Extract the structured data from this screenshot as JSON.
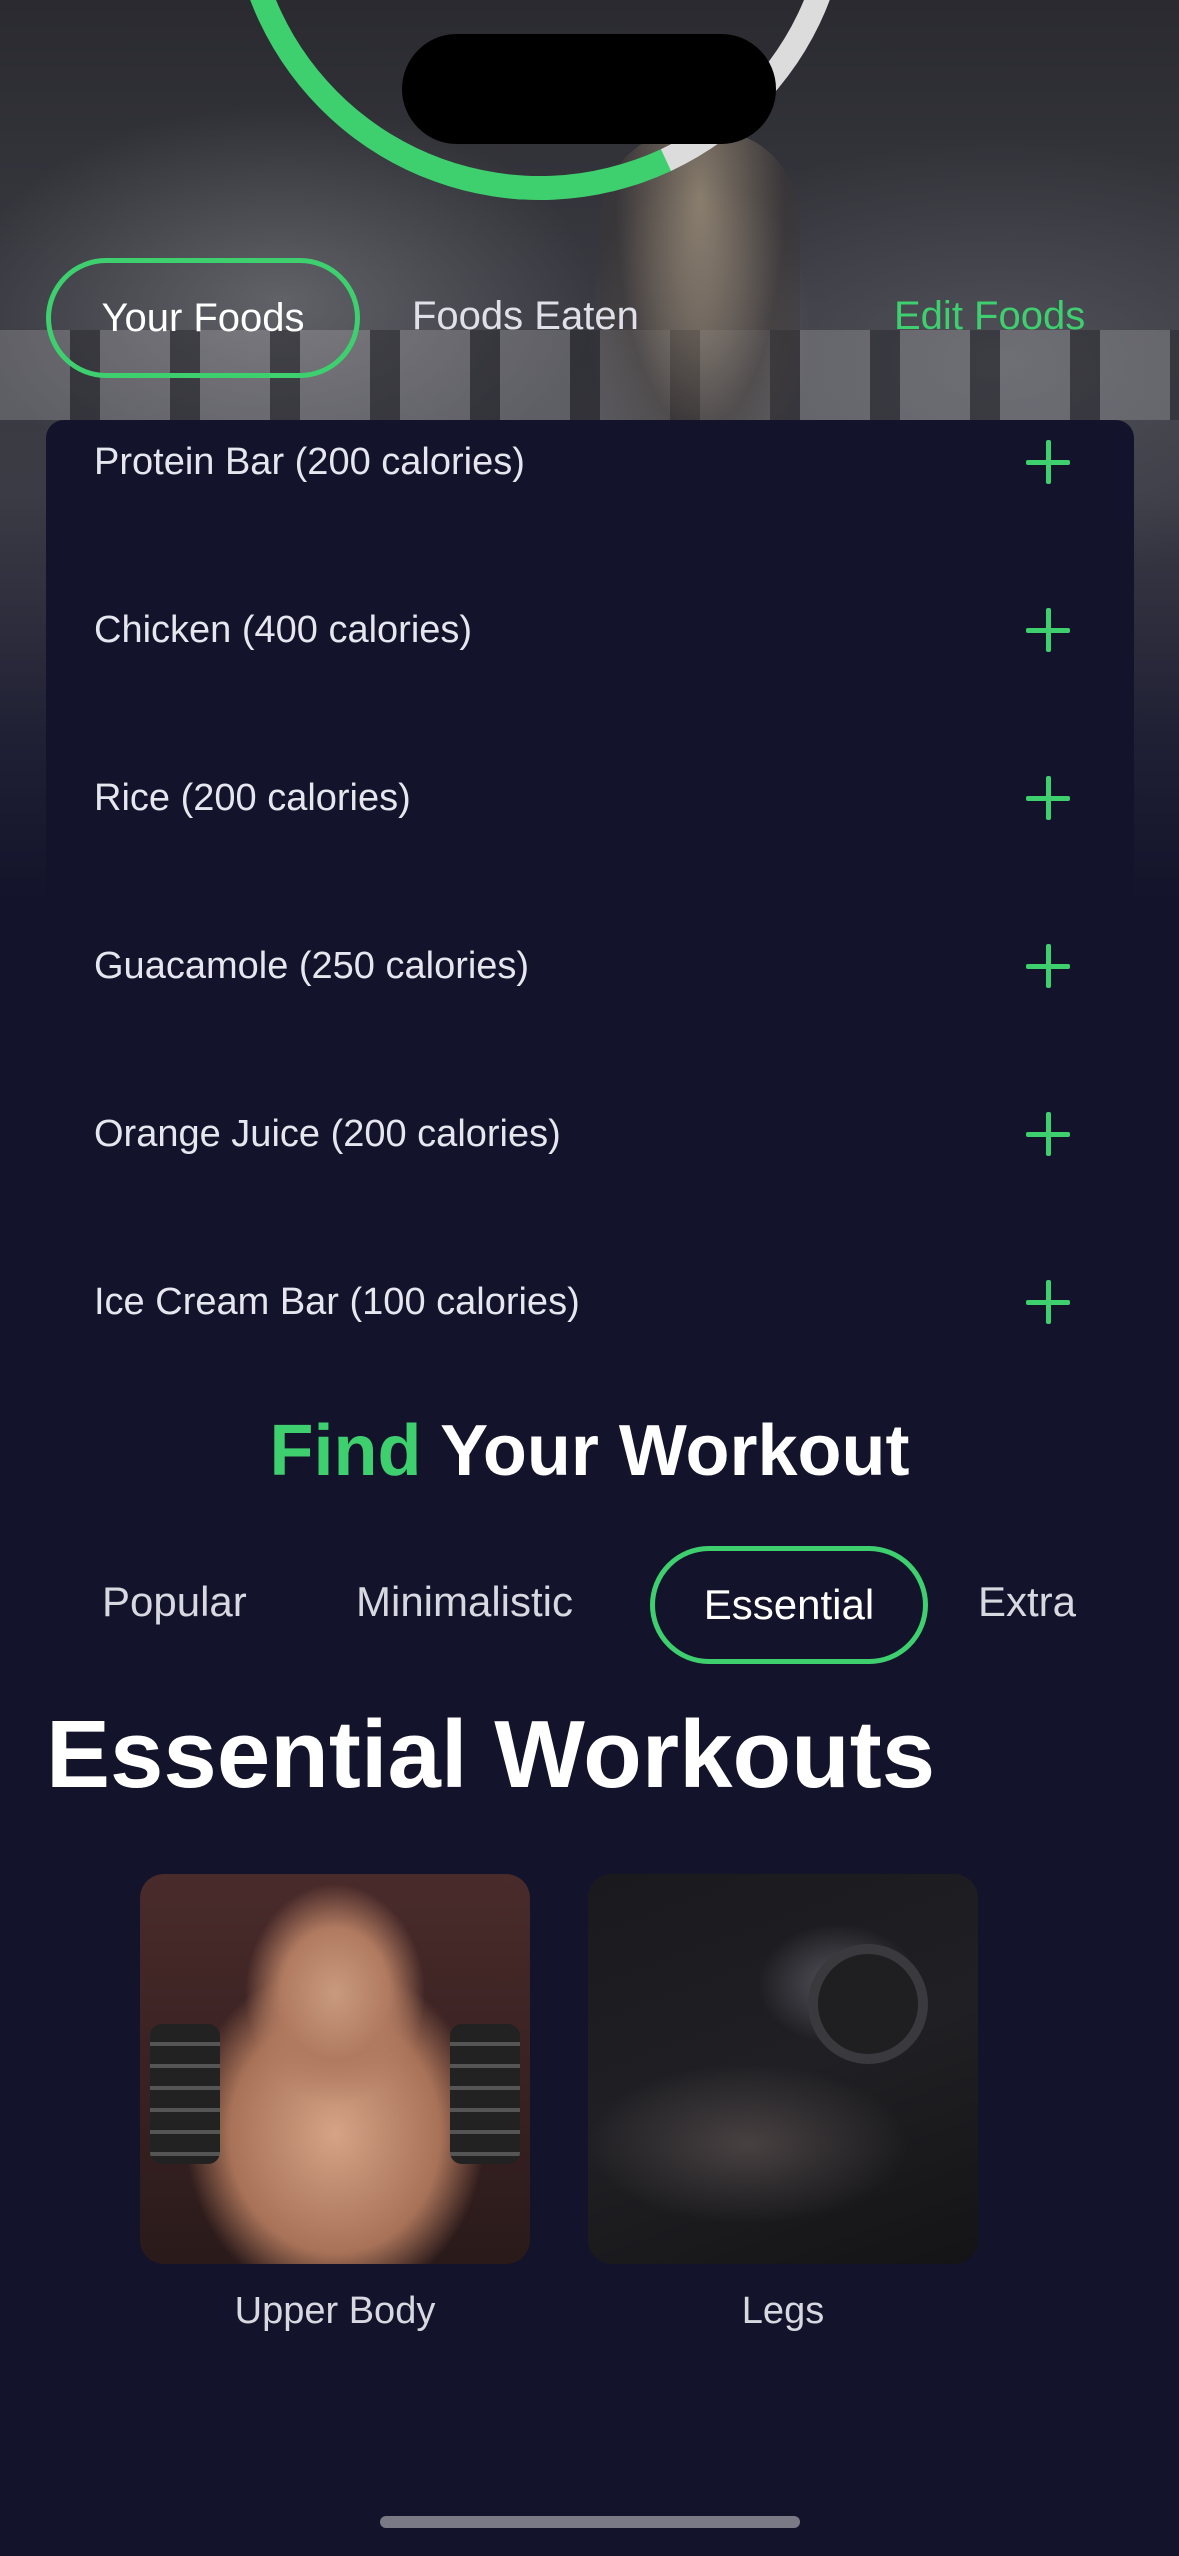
{
  "colors": {
    "accent": "#3ecf6e",
    "background": "#13132b",
    "ring_track": "#dcdcdc"
  },
  "food_tabs": {
    "your_foods": "Your Foods",
    "foods_eaten": "Foods Eaten",
    "edit_foods": "Edit Foods",
    "selected": "Your Foods"
  },
  "foods": [
    {
      "label": "Protein Bar (200 calories)",
      "action_icon": "plus-icon"
    },
    {
      "label": "Chicken (400 calories)",
      "action_icon": "plus-icon"
    },
    {
      "label": "Rice (200 calories)",
      "action_icon": "plus-icon"
    },
    {
      "label": "Guacamole (250 calories)",
      "action_icon": "plus-icon"
    },
    {
      "label": "Orange Juice (200 calories)",
      "action_icon": "plus-icon"
    },
    {
      "label": "Ice Cream Bar (100 calories)",
      "action_icon": "plus-icon"
    }
  ],
  "find_workout": {
    "accent_word": "Find",
    "rest": "Your Workout"
  },
  "workout_tabs": {
    "items": [
      "Popular",
      "Minimalistic",
      "Essential",
      "Extra"
    ],
    "selected": "Essential"
  },
  "section_title": "Essential Workouts",
  "workouts": [
    {
      "label": "Upper Body"
    },
    {
      "label": "Legs"
    }
  ]
}
